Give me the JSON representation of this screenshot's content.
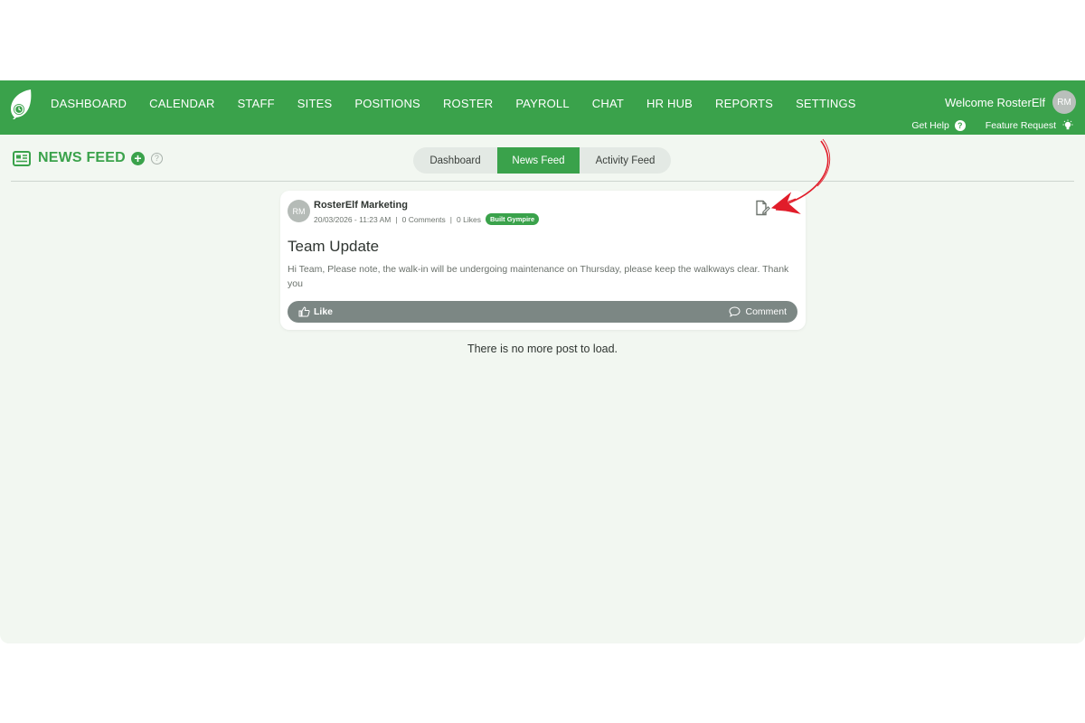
{
  "nav": {
    "items": [
      "DASHBOARD",
      "CALENDAR",
      "STAFF",
      "SITES",
      "POSITIONS",
      "ROSTER",
      "PAYROLL",
      "CHAT",
      "HR HUB",
      "REPORTS",
      "SETTINGS"
    ]
  },
  "user": {
    "welcome": "Welcome RosterElf",
    "initials": "RM"
  },
  "help_links": {
    "get_help": "Get Help",
    "feature_request": "Feature Request"
  },
  "page": {
    "title": "NEWS FEED",
    "add_icon": "+",
    "help_icon": "?"
  },
  "tabs": [
    "Dashboard",
    "News Feed",
    "Activity Feed"
  ],
  "post": {
    "avatar": "RM",
    "author": "RosterElf Marketing",
    "timestamp": "20/03/2026 - 11:23 AM",
    "comments": "0 Comments",
    "likes": "0 Likes",
    "site_badge": "Built Gympire",
    "title": "Team Update",
    "body": "Hi Team, Please note, the walk-in will be undergoing maintenance on Thursday, please keep the walkways clear. Thank you",
    "like_label": "Like",
    "comment_label": "Comment"
  },
  "footer_message": "There is no more post to load.",
  "colors": {
    "brand_green": "#3aa24b",
    "page_bg": "#f2f7f1",
    "action_bar": "#7c8784",
    "annotation_red": "#e11d2a"
  },
  "icons": {
    "logo": "leaf-clock-icon",
    "edit": "edit-document-icon",
    "like": "thumbs-up-icon",
    "comment": "speech-bubble-icon",
    "news": "newspaper-icon",
    "help": "question-circle-icon",
    "bulb": "lightbulb-icon"
  }
}
